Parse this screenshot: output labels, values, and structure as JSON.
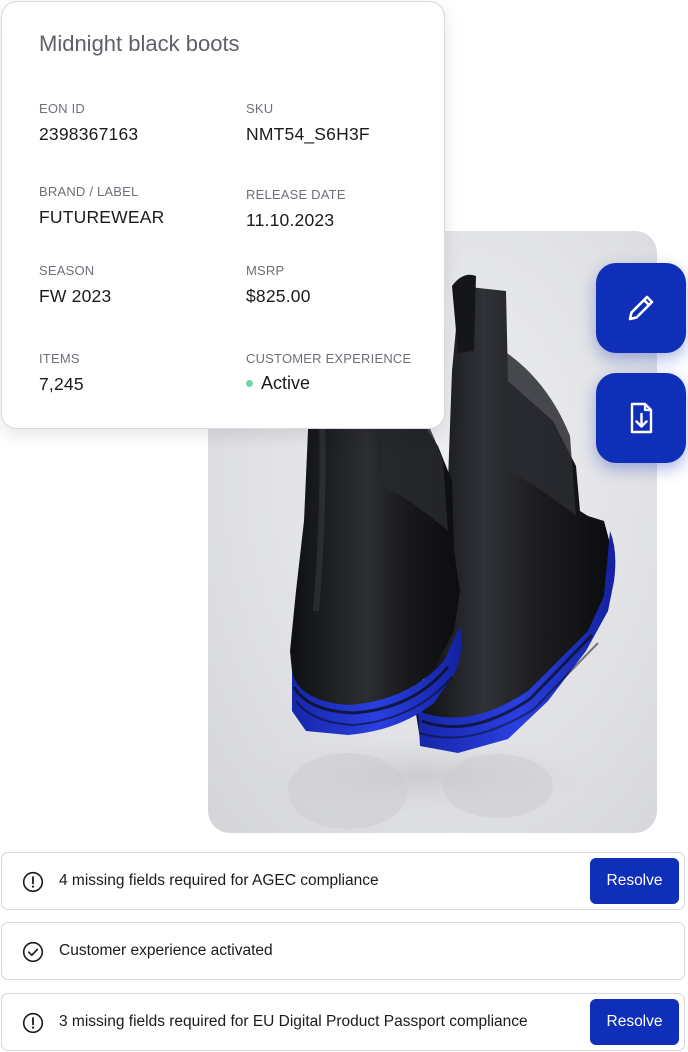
{
  "product": {
    "title": "Midnight black boots",
    "fields": {
      "eon_id": {
        "label": "EON ID",
        "value": "2398367163"
      },
      "sku": {
        "label": "SKU",
        "value": "NMT54_S6H3F"
      },
      "brand": {
        "label": "BRAND / LABEL",
        "value": "FUTUREWEAR"
      },
      "release_date": {
        "label": "RELEASE DATE",
        "value": "11.10.2023"
      },
      "season": {
        "label": "SEASON",
        "value": "FW 2023"
      },
      "msrp": {
        "label": "MSRP",
        "value": "$825.00"
      },
      "items": {
        "label": "ITEMS",
        "value": "7,245"
      },
      "customer_experience": {
        "label": "CUSTOMER EXPERIENCE",
        "value": "Active"
      }
    }
  },
  "actions": {
    "edit_icon": "pencil-icon",
    "download_icon": "file-download-icon"
  },
  "notices": [
    {
      "icon": "alert-circle-icon",
      "text": "4 missing fields required for AGEC compliance",
      "button": "Resolve"
    },
    {
      "icon": "check-circle-icon",
      "text": "Customer experience activated"
    },
    {
      "icon": "alert-circle-icon",
      "text": "3 missing fields required for EU Digital Product Passport compliance",
      "button": "Resolve"
    }
  ],
  "colors": {
    "accent": "#0f2fb8",
    "status_active": "#6fd6a6",
    "boot_leather": "#1c1d20",
    "boot_sole": "#2233c4"
  }
}
